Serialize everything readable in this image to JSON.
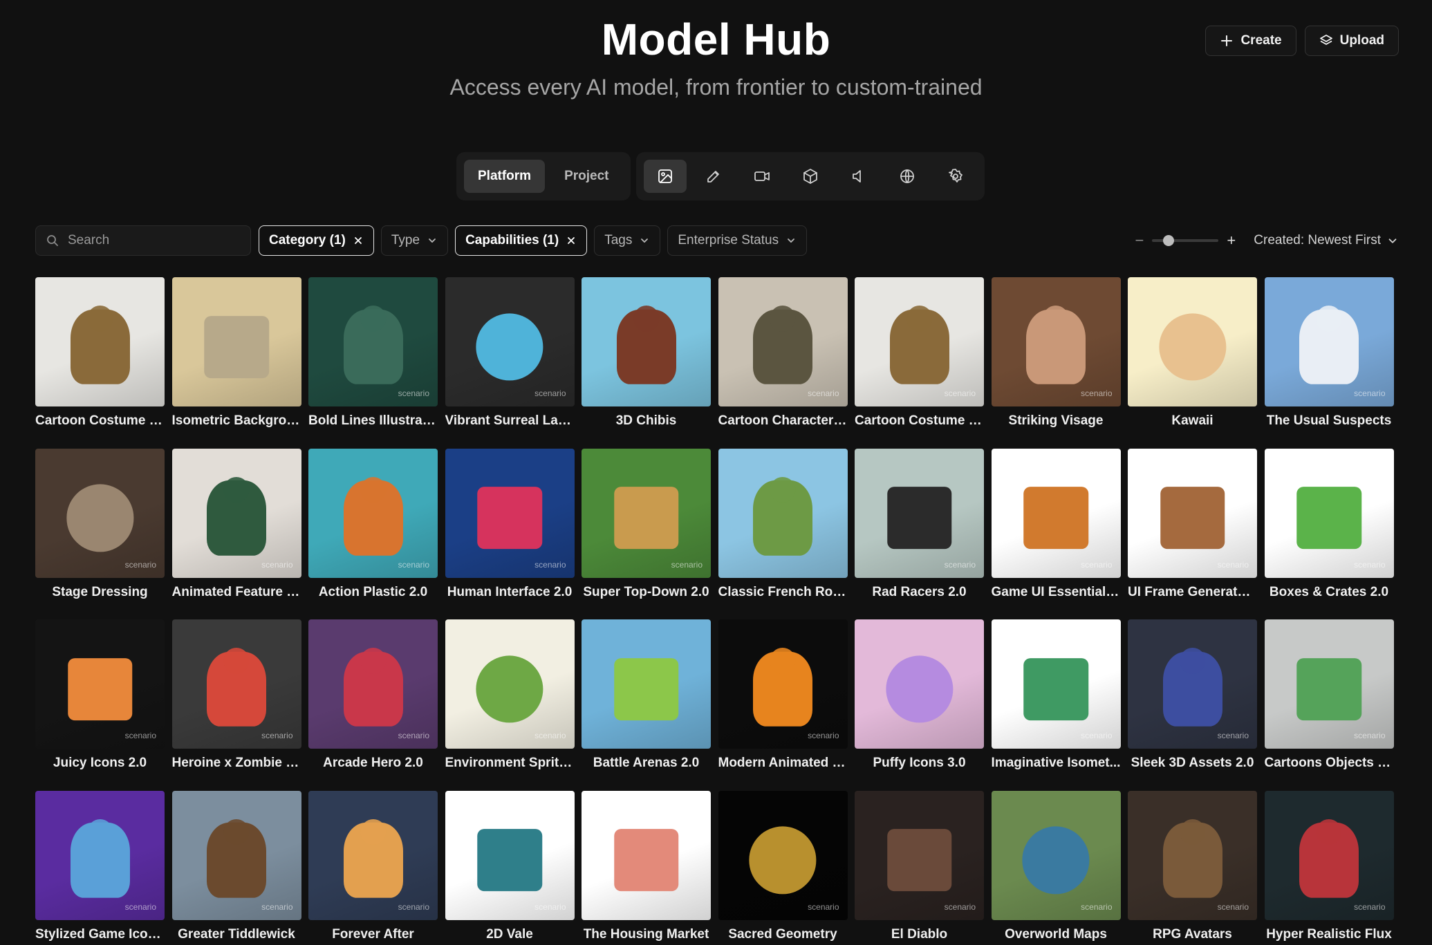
{
  "header": {
    "title": "Model Hub",
    "subtitle": "Access every AI model, from frontier to custom-trained",
    "create_label": "Create",
    "upload_label": "Upload"
  },
  "scope_tabs": [
    {
      "label": "Platform",
      "active": true
    },
    {
      "label": "Project",
      "active": false
    }
  ],
  "media_toggles": [
    {
      "icon": "image-icon",
      "active": true
    },
    {
      "icon": "edit-icon",
      "active": false
    },
    {
      "icon": "video-icon",
      "active": false
    },
    {
      "icon": "cube-3d-icon",
      "active": false
    },
    {
      "icon": "audio-icon",
      "active": false
    },
    {
      "icon": "globe-icon",
      "active": false
    },
    {
      "icon": "settings-icon",
      "active": false
    }
  ],
  "filters": {
    "search_placeholder": "Search",
    "chips": [
      {
        "label": "Category (1)",
        "selected": true
      },
      {
        "label": "Type",
        "selected": false
      },
      {
        "label": "Capabilities (1)",
        "selected": true
      },
      {
        "label": "Tags",
        "selected": false
      },
      {
        "label": "Enterprise Status",
        "selected": false
      }
    ],
    "zoom_level": 0.25,
    "sort_label": "Created: Newest First"
  },
  "watermark": "scenario",
  "models": [
    {
      "name": "Cartoon Costume S...",
      "bg": "#e7e6e2",
      "fg": "#8a6a3a",
      "shape": "fig",
      "wm": false
    },
    {
      "name": "Isometric Backgrou...",
      "bg": "#d9c79a",
      "fg": "#b7a98a",
      "shape": "box",
      "wm": false
    },
    {
      "name": "Bold Lines Illustratio...",
      "bg": "#1f4a3f",
      "fg": "#3a6b5a",
      "shape": "fig",
      "wm": true
    },
    {
      "name": "Vibrant Surreal Lan...",
      "bg": "#2b2b2b",
      "fg": "#4fb3d9",
      "shape": "round",
      "wm": true
    },
    {
      "name": "3D Chibis",
      "bg": "#7cc4df",
      "fg": "#7a3b28",
      "shape": "fig",
      "wm": false
    },
    {
      "name": "Cartoon Characters...",
      "bg": "#c9c1b3",
      "fg": "#5b5540",
      "shape": "fig",
      "wm": true
    },
    {
      "name": "Cartoon Costume S...",
      "bg": "#e7e6e2",
      "fg": "#8a6a3a",
      "shape": "fig",
      "wm": true
    },
    {
      "name": "Striking Visage",
      "bg": "#6e4a33",
      "fg": "#c99878",
      "shape": "fig",
      "wm": true
    },
    {
      "name": "Kawaii",
      "bg": "#f7eec8",
      "fg": "#e8c18f",
      "shape": "round",
      "wm": false
    },
    {
      "name": "The Usual Suspects",
      "bg": "#7aa9d9",
      "fg": "#e9eef5",
      "shape": "fig",
      "wm": true
    },
    {
      "name": "Stage Dressing",
      "bg": "#4a3a30",
      "fg": "#9a8670",
      "shape": "round",
      "wm": true
    },
    {
      "name": "Animated Feature 2...",
      "bg": "#e2ddd7",
      "fg": "#2f5a3e",
      "shape": "fig",
      "wm": true
    },
    {
      "name": "Action Plastic 2.0",
      "bg": "#3fa9b8",
      "fg": "#d8742f",
      "shape": "fig",
      "wm": true
    },
    {
      "name": "Human Interface 2.0",
      "bg": "#1b3f86",
      "fg": "#d6335d",
      "shape": "box",
      "wm": true
    },
    {
      "name": "Super Top-Down 2.0",
      "bg": "#4c8a39",
      "fg": "#c99b4e",
      "shape": "box",
      "wm": true
    },
    {
      "name": "Classic French Roas...",
      "bg": "#8cc5e3",
      "fg": "#6d9a45",
      "shape": "fig",
      "wm": false
    },
    {
      "name": "Rad Racers 2.0",
      "bg": "#b6c7c2",
      "fg": "#2b2b2b",
      "shape": "box",
      "wm": true
    },
    {
      "name": "Game UI Essentials ...",
      "bg": "#ffffff",
      "fg": "#d17a2e",
      "shape": "box",
      "wm": true
    },
    {
      "name": "UI Frame Generator...",
      "bg": "#ffffff",
      "fg": "#a56a3e",
      "shape": "box",
      "wm": true
    },
    {
      "name": "Boxes & Crates 2.0",
      "bg": "#ffffff",
      "fg": "#5bb34a",
      "shape": "box",
      "wm": true
    },
    {
      "name": "Juicy Icons 2.0",
      "bg": "#141414",
      "fg": "#e7863a",
      "shape": "box",
      "wm": true
    },
    {
      "name": "Heroine x Zombie 2....",
      "bg": "#3a3a3a",
      "fg": "#d5483a",
      "shape": "fig",
      "wm": true
    },
    {
      "name": "Arcade Hero 2.0",
      "bg": "#5a3b6e",
      "fg": "#c9374a",
      "shape": "fig",
      "wm": true
    },
    {
      "name": "Environment Sprites...",
      "bg": "#f2efe2",
      "fg": "#6ea845",
      "shape": "round",
      "wm": true
    },
    {
      "name": "Battle Arenas 2.0",
      "bg": "#6fb2d9",
      "fg": "#8cc74a",
      "shape": "box",
      "wm": false
    },
    {
      "name": "Modern Animated F...",
      "bg": "#0c0c0c",
      "fg": "#e7841e",
      "shape": "fig",
      "wm": true
    },
    {
      "name": "Puffy Icons 3.0",
      "bg": "#e3b9d9",
      "fg": "#b58be0",
      "shape": "round",
      "wm": false
    },
    {
      "name": "Imaginative Isomet...",
      "bg": "#ffffff",
      "fg": "#3f9a63",
      "shape": "box",
      "wm": true
    },
    {
      "name": "Sleek 3D Assets 2.0",
      "bg": "#2e3342",
      "fg": "#3d4ea0",
      "shape": "fig",
      "wm": true
    },
    {
      "name": "Cartoons Objects 2.0",
      "bg": "#c7c9c8",
      "fg": "#55a35a",
      "shape": "box",
      "wm": true
    },
    {
      "name": "Stylized Game Icon...",
      "bg": "#5a2ca0",
      "fg": "#5aa0d8",
      "shape": "fig",
      "wm": true
    },
    {
      "name": "Greater Tiddlewick",
      "bg": "#7c8e9e",
      "fg": "#6b4a2e",
      "shape": "fig",
      "wm": true
    },
    {
      "name": "Forever After",
      "bg": "#2f3c55",
      "fg": "#e3a04f",
      "shape": "fig",
      "wm": true
    },
    {
      "name": "2D Vale",
      "bg": "#ffffff",
      "fg": "#2f7f8a",
      "shape": "box",
      "wm": true
    },
    {
      "name": "The Housing Market",
      "bg": "#ffffff",
      "fg": "#e38a7a",
      "shape": "box",
      "wm": false
    },
    {
      "name": "Sacred Geometry",
      "bg": "#050505",
      "fg": "#b8902e",
      "shape": "round",
      "wm": true
    },
    {
      "name": "El Diablo",
      "bg": "#2a2220",
      "fg": "#6a4a3a",
      "shape": "box",
      "wm": true
    },
    {
      "name": "Overworld Maps",
      "bg": "#6b8a4f",
      "fg": "#3a7aa0",
      "shape": "round",
      "wm": true
    },
    {
      "name": "RPG Avatars",
      "bg": "#3a2f28",
      "fg": "#7a5a3a",
      "shape": "fig",
      "wm": true
    },
    {
      "name": "Hyper Realistic Flux",
      "bg": "#1e2a2e",
      "fg": "#b8343a",
      "shape": "fig",
      "wm": true
    }
  ]
}
